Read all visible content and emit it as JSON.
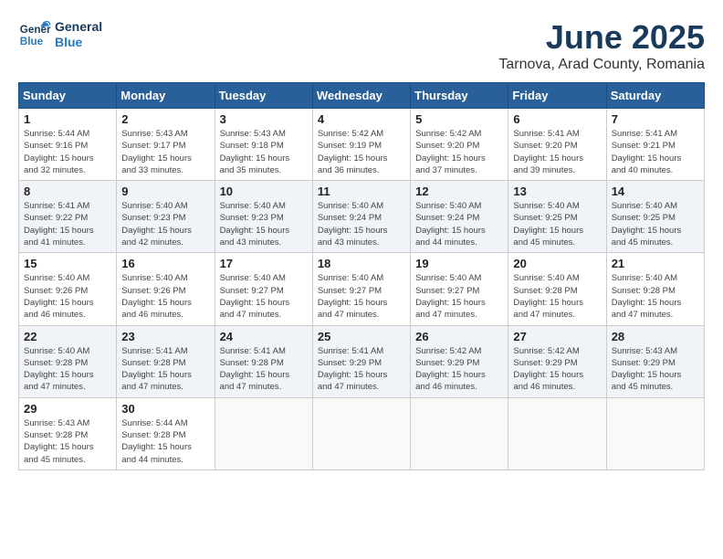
{
  "header": {
    "logo_line1": "General",
    "logo_line2": "Blue",
    "month": "June 2025",
    "location": "Tarnova, Arad County, Romania"
  },
  "weekdays": [
    "Sunday",
    "Monday",
    "Tuesday",
    "Wednesday",
    "Thursday",
    "Friday",
    "Saturday"
  ],
  "weeks": [
    [
      {
        "day": "1",
        "sunrise": "5:44 AM",
        "sunset": "9:16 PM",
        "daylight": "15 hours and 32 minutes."
      },
      {
        "day": "2",
        "sunrise": "5:43 AM",
        "sunset": "9:17 PM",
        "daylight": "15 hours and 33 minutes."
      },
      {
        "day": "3",
        "sunrise": "5:43 AM",
        "sunset": "9:18 PM",
        "daylight": "15 hours and 35 minutes."
      },
      {
        "day": "4",
        "sunrise": "5:42 AM",
        "sunset": "9:19 PM",
        "daylight": "15 hours and 36 minutes."
      },
      {
        "day": "5",
        "sunrise": "5:42 AM",
        "sunset": "9:20 PM",
        "daylight": "15 hours and 37 minutes."
      },
      {
        "day": "6",
        "sunrise": "5:41 AM",
        "sunset": "9:20 PM",
        "daylight": "15 hours and 39 minutes."
      },
      {
        "day": "7",
        "sunrise": "5:41 AM",
        "sunset": "9:21 PM",
        "daylight": "15 hours and 40 minutes."
      }
    ],
    [
      {
        "day": "8",
        "sunrise": "5:41 AM",
        "sunset": "9:22 PM",
        "daylight": "15 hours and 41 minutes."
      },
      {
        "day": "9",
        "sunrise": "5:40 AM",
        "sunset": "9:23 PM",
        "daylight": "15 hours and 42 minutes."
      },
      {
        "day": "10",
        "sunrise": "5:40 AM",
        "sunset": "9:23 PM",
        "daylight": "15 hours and 43 minutes."
      },
      {
        "day": "11",
        "sunrise": "5:40 AM",
        "sunset": "9:24 PM",
        "daylight": "15 hours and 43 minutes."
      },
      {
        "day": "12",
        "sunrise": "5:40 AM",
        "sunset": "9:24 PM",
        "daylight": "15 hours and 44 minutes."
      },
      {
        "day": "13",
        "sunrise": "5:40 AM",
        "sunset": "9:25 PM",
        "daylight": "15 hours and 45 minutes."
      },
      {
        "day": "14",
        "sunrise": "5:40 AM",
        "sunset": "9:25 PM",
        "daylight": "15 hours and 45 minutes."
      }
    ],
    [
      {
        "day": "15",
        "sunrise": "5:40 AM",
        "sunset": "9:26 PM",
        "daylight": "15 hours and 46 minutes."
      },
      {
        "day": "16",
        "sunrise": "5:40 AM",
        "sunset": "9:26 PM",
        "daylight": "15 hours and 46 minutes."
      },
      {
        "day": "17",
        "sunrise": "5:40 AM",
        "sunset": "9:27 PM",
        "daylight": "15 hours and 47 minutes."
      },
      {
        "day": "18",
        "sunrise": "5:40 AM",
        "sunset": "9:27 PM",
        "daylight": "15 hours and 47 minutes."
      },
      {
        "day": "19",
        "sunrise": "5:40 AM",
        "sunset": "9:27 PM",
        "daylight": "15 hours and 47 minutes."
      },
      {
        "day": "20",
        "sunrise": "5:40 AM",
        "sunset": "9:28 PM",
        "daylight": "15 hours and 47 minutes."
      },
      {
        "day": "21",
        "sunrise": "5:40 AM",
        "sunset": "9:28 PM",
        "daylight": "15 hours and 47 minutes."
      }
    ],
    [
      {
        "day": "22",
        "sunrise": "5:40 AM",
        "sunset": "9:28 PM",
        "daylight": "15 hours and 47 minutes."
      },
      {
        "day": "23",
        "sunrise": "5:41 AM",
        "sunset": "9:28 PM",
        "daylight": "15 hours and 47 minutes."
      },
      {
        "day": "24",
        "sunrise": "5:41 AM",
        "sunset": "9:28 PM",
        "daylight": "15 hours and 47 minutes."
      },
      {
        "day": "25",
        "sunrise": "5:41 AM",
        "sunset": "9:29 PM",
        "daylight": "15 hours and 47 minutes."
      },
      {
        "day": "26",
        "sunrise": "5:42 AM",
        "sunset": "9:29 PM",
        "daylight": "15 hours and 46 minutes."
      },
      {
        "day": "27",
        "sunrise": "5:42 AM",
        "sunset": "9:29 PM",
        "daylight": "15 hours and 46 minutes."
      },
      {
        "day": "28",
        "sunrise": "5:43 AM",
        "sunset": "9:29 PM",
        "daylight": "15 hours and 45 minutes."
      }
    ],
    [
      {
        "day": "29",
        "sunrise": "5:43 AM",
        "sunset": "9:28 PM",
        "daylight": "15 hours and 45 minutes."
      },
      {
        "day": "30",
        "sunrise": "5:44 AM",
        "sunset": "9:28 PM",
        "daylight": "15 hours and 44 minutes."
      },
      null,
      null,
      null,
      null,
      null
    ]
  ]
}
